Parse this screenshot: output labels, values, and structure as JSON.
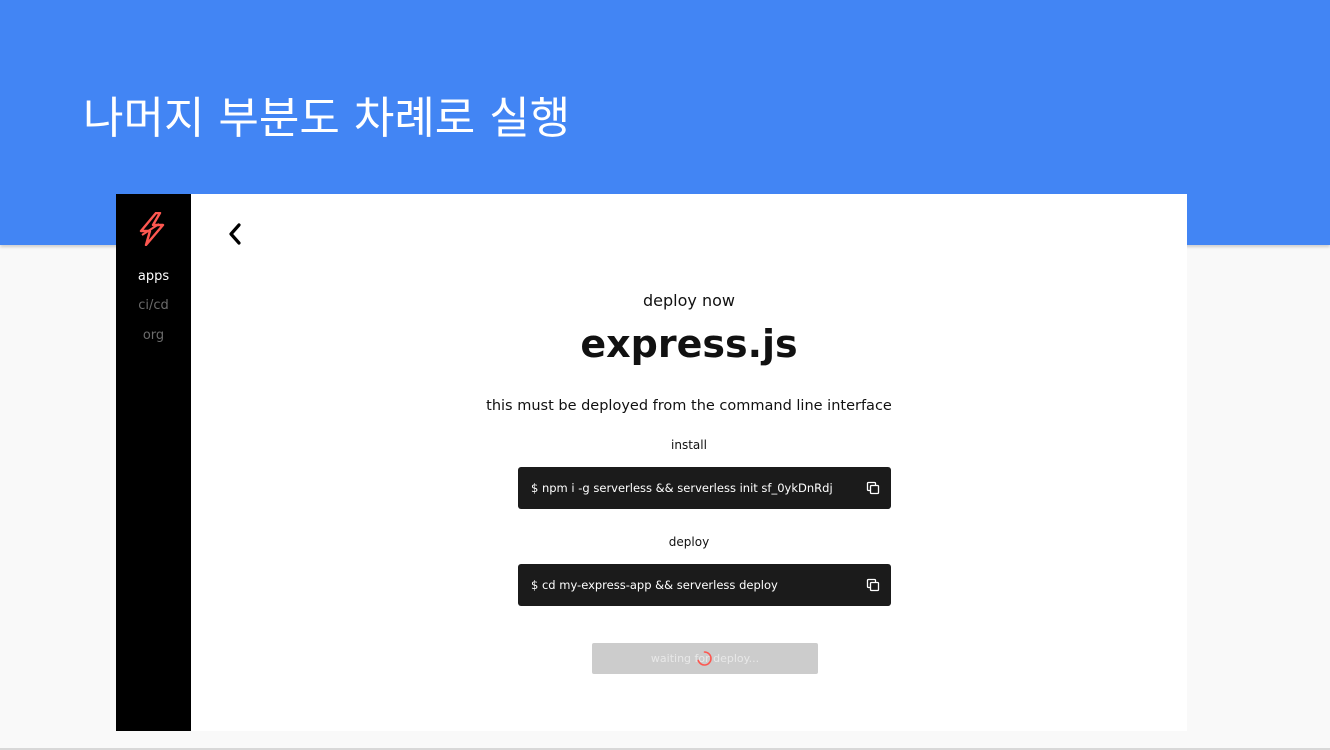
{
  "slide": {
    "title": "나머지 부분도 차례로 실행"
  },
  "sidebar": {
    "logo_icon": "lightning-bolt-icon",
    "items": [
      {
        "label": "apps",
        "active": true
      },
      {
        "label": "ci/cd",
        "active": false
      },
      {
        "label": "org",
        "active": false
      }
    ]
  },
  "main": {
    "back_icon": "chevron-left-icon",
    "heading": "deploy now",
    "app_name": "express.js",
    "subtitle": "this must be deployed from the command line interface",
    "install": {
      "label": "install",
      "command": "$  npm i -g serverless && serverless init sf_0ykDnRdj",
      "copy_icon": "copy-icon"
    },
    "deploy": {
      "label": "deploy",
      "command": "$  cd my-express-app && serverless deploy",
      "copy_icon": "copy-icon"
    },
    "status_button": {
      "label": "waiting for deploy...",
      "spinner_icon": "spinner-icon"
    }
  },
  "colors": {
    "header_blue": "#4285f4",
    "sidebar_bg": "#000000",
    "command_bg": "#1b1b1b",
    "logo_red": "#fd5750",
    "button_disabled": "#cccccc"
  }
}
